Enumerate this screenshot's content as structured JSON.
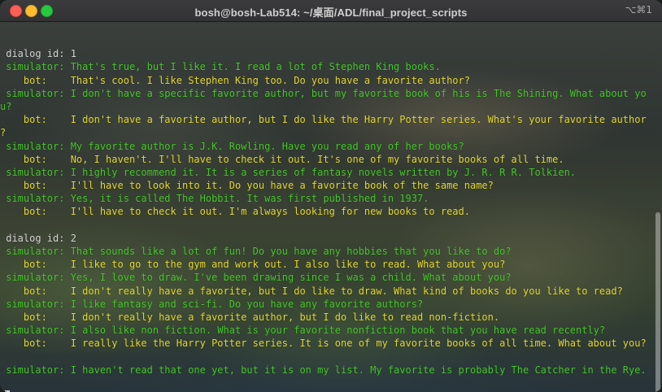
{
  "window": {
    "title": "bosh@bosh-Lab514: ~/桌面/ADL/final_project_scripts",
    "shortcut": "⌥⌘1"
  },
  "terminal": {
    "lines": [
      {
        "type": "plain",
        "text": ""
      },
      {
        "type": "plain",
        "text": " dialog id: 1"
      },
      {
        "type": "sim",
        "text": " simulator: That's true, but I like it. I read a lot of Stephen King books."
      },
      {
        "type": "bot",
        "text": "    bot:    That's cool. I like Stephen King too. Do you have a favorite author?"
      },
      {
        "type": "sim",
        "text": " simulator: I don't have a specific favorite author, but my favorite book of his is The Shining. What about yo"
      },
      {
        "type": "sim",
        "text": "u?"
      },
      {
        "type": "bot",
        "text": "    bot:    I don't have a favorite author, but I do like the Harry Potter series. What's your favorite author"
      },
      {
        "type": "bot",
        "text": "?"
      },
      {
        "type": "sim",
        "text": " simulator: My favorite author is J.K. Rowling. Have you read any of her books?"
      },
      {
        "type": "bot",
        "text": "    bot:    No, I haven't. I'll have to check it out. It's one of my favorite books of all time."
      },
      {
        "type": "sim",
        "text": " simulator: I highly recommend it. It is a series of fantasy novels written by J. R. R R. Tolkien."
      },
      {
        "type": "bot",
        "text": "    bot:    I'll have to look into it. Do you have a favorite book of the same name?"
      },
      {
        "type": "sim",
        "text": " simulator: Yes, it is called The Hobbit. It was first published in 1937."
      },
      {
        "type": "bot",
        "text": "    bot:    I'll have to check it out. I'm always looking for new books to read."
      },
      {
        "type": "plain",
        "text": ""
      },
      {
        "type": "plain",
        "text": " dialog id: 2"
      },
      {
        "type": "sim",
        "text": " simulator: That sounds like a lot of fun! Do you have any hobbies that you like to do?"
      },
      {
        "type": "bot",
        "text": "    bot:    I like to go to the gym and work out. I also like to read. What about you?"
      },
      {
        "type": "sim",
        "text": " simulator: Yes, I love to draw. I've been drawing since I was a child. What about you?"
      },
      {
        "type": "bot",
        "text": "    bot:    I don't really have a favorite, but I do like to draw. What kind of books do you like to read?"
      },
      {
        "type": "sim",
        "text": " simulator: I like fantasy and sci-fi. Do you have any favorite authors?"
      },
      {
        "type": "bot",
        "text": "    bot:    I don't really have a favorite author, but I do like to read non-fiction."
      },
      {
        "type": "sim",
        "text": " simulator: I also like non fiction. What is your favorite nonfiction book that you have read recently?"
      },
      {
        "type": "bot",
        "text": "    bot:    I really like the Harry Potter series. It is one of my favorite books of all time. What about you?"
      },
      {
        "type": "plain",
        "text": ""
      },
      {
        "type": "sim",
        "text": " simulator: I haven't read that one yet, but it is on my list. My favorite is probably The Catcher in the Rye."
      },
      {
        "type": "plain",
        "text": ""
      }
    ]
  },
  "colors": {
    "simulator": "#46c82a",
    "bot": "#e4d82e",
    "plain": "#d4d4d4"
  }
}
